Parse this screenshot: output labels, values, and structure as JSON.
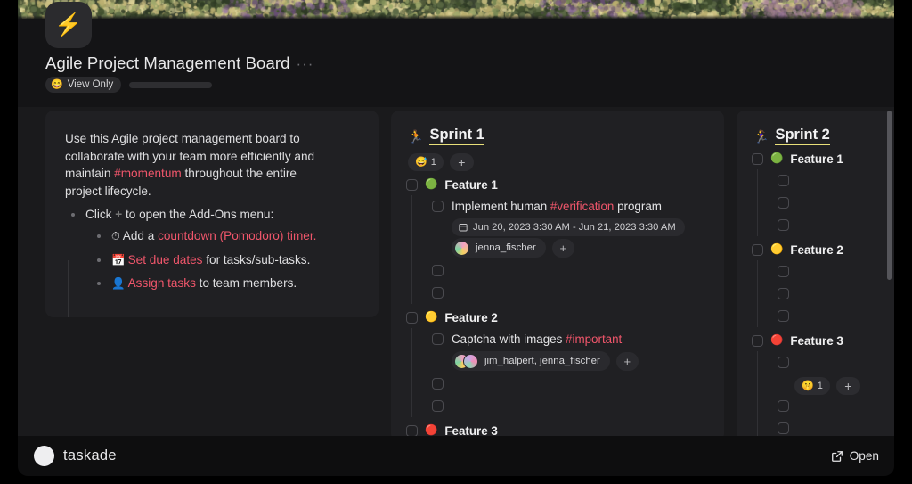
{
  "header": {
    "doc_icon": "⚡",
    "title": "Agile Project Management Board",
    "title_more": "···",
    "view_only_emoji": "😄",
    "view_only_label": "View Only"
  },
  "description": {
    "paragraph_1": "Use this Agile project management board to collaborate with your team more efficiently and maintain ",
    "tag_momentum": "#momentum",
    "paragraph_1_end": " throughout the entire project lifecycle.",
    "bullet_click_pre": "Click ",
    "bullet_click_plus": "+",
    "bullet_click_post": " to open the Add-Ons menu:",
    "sub_bullets": [
      {
        "emoji": "⏱",
        "pre": "Add a ",
        "link": "countdown (Pomodoro) timer.",
        "post": ""
      },
      {
        "emoji": "📅",
        "pre": "",
        "link": "Set due dates",
        "post": " for tasks/sub-tasks."
      },
      {
        "emoji": "👤",
        "pre": "",
        "link": "Assign tasks",
        "post": " to team members."
      }
    ]
  },
  "sprint1": {
    "runner_emoji": "🏃",
    "title": "Sprint 1",
    "reaction_emoji": "😅",
    "reaction_count": "1",
    "add_label": "+",
    "features": [
      {
        "dot": "🟢",
        "label": "Feature 1",
        "subtasks": [
          {
            "text_pre": "Implement human ",
            "tag": "#verification",
            "text_post": " program",
            "date": "Jun 20, 2023 3:30 AM - Jun 21, 2023 3:30 AM",
            "assignees": "jenna_fischer",
            "avatar_count": 1,
            "add_label": "+"
          }
        ],
        "empty_rows": 2
      },
      {
        "dot": "🟡",
        "label": "Feature 2",
        "subtasks": [
          {
            "text_pre": "Captcha with images ",
            "tag": "#important",
            "text_post": "",
            "date": "",
            "assignees": "jim_halpert, jenna_fischer",
            "avatar_count": 2,
            "add_label": "+"
          }
        ],
        "empty_rows": 2
      },
      {
        "dot": "🔴",
        "label": "Feature 3",
        "subtasks": [],
        "empty_rows": 0
      }
    ]
  },
  "sprint2": {
    "runner_emoji": "🏃‍♀️",
    "title": "Sprint 2",
    "features": [
      {
        "dot": "🟢",
        "label": "Feature 1",
        "empty_rows": 3
      },
      {
        "dot": "🟡",
        "label": "Feature 2",
        "empty_rows": 3
      },
      {
        "dot": "🔴",
        "label": "Feature 3",
        "empty_rows": 1
      }
    ],
    "reaction_emoji": "🤫",
    "reaction_count": "1",
    "add_label": "+",
    "trailing_empty_rows": 2
  },
  "bottombar": {
    "brand": "taskade",
    "open_label": "Open"
  },
  "colors": {
    "page_bg": "#000000",
    "frame_bg": "#1a1a1c",
    "card_bg": "#202023",
    "accent_underline": "#e9e07a",
    "tag_red": "#f0566b",
    "bottom_bar_bg": "#0e0e0f"
  }
}
